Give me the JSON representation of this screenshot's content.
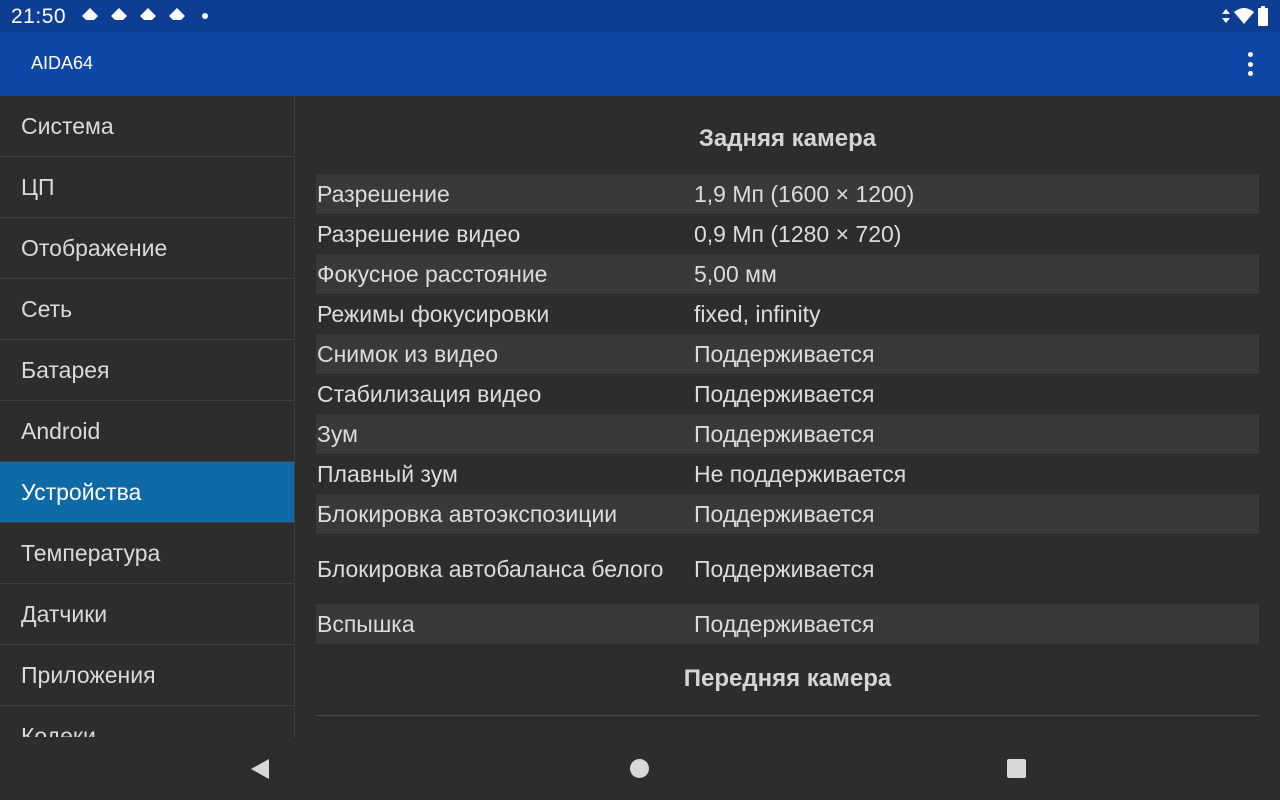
{
  "status_bar": {
    "time": "21:50"
  },
  "app_bar": {
    "title": "AIDA64",
    "menu_icon": "overflow-menu-icon"
  },
  "sidebar": {
    "items": [
      {
        "label": "Система"
      },
      {
        "label": "ЦП"
      },
      {
        "label": "Отображение"
      },
      {
        "label": "Сеть"
      },
      {
        "label": "Батарея"
      },
      {
        "label": "Android"
      },
      {
        "label": "Устройства",
        "active": true
      },
      {
        "label": "Температура"
      },
      {
        "label": "Датчики"
      },
      {
        "label": "Приложения"
      },
      {
        "label": "Кодеки"
      }
    ]
  },
  "content": {
    "rear_camera_title": "Задняя камера",
    "rear_camera_rows": [
      {
        "key": "Разрешение",
        "value": "1,9 Мп (1600 × 1200)"
      },
      {
        "key": "Разрешение видео",
        "value": "0,9 Мп (1280 × 720)"
      },
      {
        "key": "Фокусное расстояние",
        "value": "5,00 мм"
      },
      {
        "key": "Режимы фокусировки",
        "value": "fixed, infinity"
      },
      {
        "key": "Снимок из видео",
        "value": "Поддерживается"
      },
      {
        "key": "Стабилизация видео",
        "value": "Поддерживается"
      },
      {
        "key": "Зум",
        "value": "Поддерживается"
      },
      {
        "key": "Плавный зум",
        "value": "Не поддерживается"
      },
      {
        "key": "Блокировка автоэкспозиции",
        "value": "Поддерживается"
      },
      {
        "key": "Блокировка автобаланса белого",
        "value": "Поддерживается"
      },
      {
        "key": "Вспышка",
        "value": "Поддерживается"
      }
    ],
    "front_camera_title": "Передняя камера"
  },
  "colors": {
    "status_bar": "#0d3e93",
    "app_bar": "#0f47a8",
    "active_item": "#0e6aa6",
    "background": "#2d2d2d",
    "row_shade": "#393939"
  }
}
